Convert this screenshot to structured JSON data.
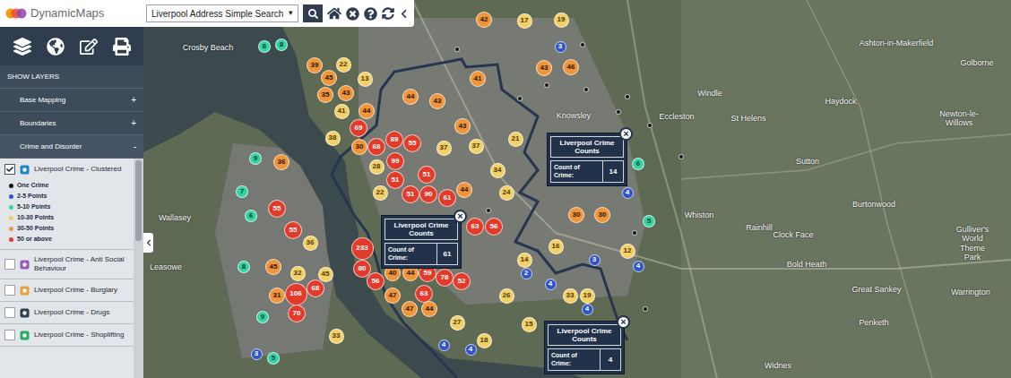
{
  "app": {
    "logo_text": "DynamicMaps"
  },
  "search": {
    "value": "Liverpool Address Simple Search",
    "caret": "▾"
  },
  "sidebar": {
    "header": "SHOW LAYERS",
    "groups": [
      {
        "label": "Base Mapping",
        "toggle": "+",
        "expanded": false
      },
      {
        "label": "Boundaries",
        "toggle": "+",
        "expanded": false
      },
      {
        "label": "Crime and Disorder",
        "toggle": "-",
        "expanded": true
      }
    ],
    "layers": [
      {
        "label": "Liverpool Crime - Clustered",
        "checked": true
      },
      {
        "label": "Liverpool Crime - Anti Social Behaviour",
        "checked": false
      },
      {
        "label": "Liverpool Crime - Burglary",
        "checked": false
      },
      {
        "label": "Liverpool Crime - Drugs",
        "checked": false
      },
      {
        "label": "Liverpool Crime - Shoplifting",
        "checked": false
      }
    ],
    "legend": [
      {
        "label": "One Crime",
        "color": "#111111"
      },
      {
        "label": "2-5 Points",
        "color": "#2f55c8"
      },
      {
        "label": "5-10 Points",
        "color": "#34d3a4"
      },
      {
        "label": "10-30 Points",
        "color": "#f2d067"
      },
      {
        "label": "30-50 Points",
        "color": "#f0953a"
      },
      {
        "label": "50 or above",
        "color": "#e23b2b"
      }
    ]
  },
  "map": {
    "place_labels": [
      "Crosby Beach",
      "Wallasey",
      "Leasowe",
      "Knowsley",
      "Windle",
      "Eccleston",
      "St Helens",
      "Haydock",
      "Ashton-in-Makerfield",
      "Golborne",
      "Newton-le-Willows",
      "Sutton",
      "Whiston",
      "Rainhill",
      "Clock Face",
      "Burtonwood",
      "Bold Heath",
      "Great Sankey",
      "Warrington",
      "Penketh",
      "Widnes",
      "Gulliver's World Theme Park"
    ],
    "pins": [
      {
        "count": "6",
        "color": "#34d3a4"
      },
      {
        "count": "8",
        "color": "#34d3a4"
      },
      {
        "count": "39",
        "color": "#f0953a"
      },
      {
        "count": "22",
        "color": "#f2d067"
      },
      {
        "count": "45",
        "color": "#f0953a"
      },
      {
        "count": "35",
        "color": "#f0953a"
      },
      {
        "count": "43",
        "color": "#f0953a"
      },
      {
        "count": "13",
        "color": "#f2d067"
      },
      {
        "count": "41",
        "color": "#f2d067"
      },
      {
        "count": "44",
        "color": "#f0953a"
      },
      {
        "count": "38",
        "color": "#f2d067"
      },
      {
        "count": "69",
        "color": "#e23b2b"
      },
      {
        "count": "30",
        "color": "#f0953a"
      },
      {
        "count": "68",
        "color": "#e23b2b"
      },
      {
        "count": "89",
        "color": "#e23b2b"
      },
      {
        "count": "55",
        "color": "#e23b2b"
      },
      {
        "count": "99",
        "color": "#e23b2b"
      },
      {
        "count": "28",
        "color": "#f2d067"
      },
      {
        "count": "51",
        "color": "#e23b2b"
      },
      {
        "count": "51",
        "color": "#e23b2b"
      },
      {
        "count": "51",
        "color": "#e23b2b"
      },
      {
        "count": "90",
        "color": "#e23b2b"
      },
      {
        "count": "61",
        "color": "#e23b2b"
      },
      {
        "count": "44",
        "color": "#f0953a"
      },
      {
        "count": "22",
        "color": "#f2d067"
      },
      {
        "count": "44",
        "color": "#f0953a"
      },
      {
        "count": "43",
        "color": "#f0953a"
      },
      {
        "count": "43",
        "color": "#f0953a"
      },
      {
        "count": "41",
        "color": "#f0953a"
      },
      {
        "count": "42",
        "color": "#f0953a"
      },
      {
        "count": "43",
        "color": "#f0953a"
      },
      {
        "count": "46",
        "color": "#f0953a"
      },
      {
        "count": "17",
        "color": "#f2d067"
      },
      {
        "count": "19",
        "color": "#f2d067"
      },
      {
        "count": "37",
        "color": "#f2d067"
      },
      {
        "count": "37",
        "color": "#f2d067"
      },
      {
        "count": "34",
        "color": "#f2d067"
      },
      {
        "count": "21",
        "color": "#f2d067"
      },
      {
        "count": "24",
        "color": "#f2d067"
      },
      {
        "count": "36",
        "color": "#f0953a"
      },
      {
        "count": "55",
        "color": "#e23b2b"
      },
      {
        "count": "55",
        "color": "#e23b2b"
      },
      {
        "count": "36",
        "color": "#f2d067"
      },
      {
        "count": "45",
        "color": "#f0953a"
      },
      {
        "count": "32",
        "color": "#f2d067"
      },
      {
        "count": "45",
        "color": "#f2d067"
      },
      {
        "count": "31",
        "color": "#f0953a"
      },
      {
        "count": "106",
        "color": "#e23b2b"
      },
      {
        "count": "68",
        "color": "#e23b2b"
      },
      {
        "count": "70",
        "color": "#e23b2b"
      },
      {
        "count": "33",
        "color": "#f2d067"
      },
      {
        "count": "233",
        "color": "#e23b2b"
      },
      {
        "count": "80",
        "color": "#e23b2b"
      },
      {
        "count": "56",
        "color": "#e23b2b"
      },
      {
        "count": "40",
        "color": "#f0953a"
      },
      {
        "count": "44",
        "color": "#f0953a"
      },
      {
        "count": "59",
        "color": "#e23b2b"
      },
      {
        "count": "78",
        "color": "#e23b2b"
      },
      {
        "count": "52",
        "color": "#e23b2b"
      },
      {
        "count": "63",
        "color": "#e23b2b"
      },
      {
        "count": "47",
        "color": "#f0953a"
      },
      {
        "count": "47",
        "color": "#f0953a"
      },
      {
        "count": "44",
        "color": "#f0953a"
      },
      {
        "count": "63",
        "color": "#e23b2b"
      },
      {
        "count": "56",
        "color": "#e23b2b"
      },
      {
        "count": "30",
        "color": "#f0953a"
      },
      {
        "count": "30",
        "color": "#f0953a"
      },
      {
        "count": "33",
        "color": "#f2d067"
      },
      {
        "count": "19",
        "color": "#f2d067"
      },
      {
        "count": "16",
        "color": "#f2d067"
      },
      {
        "count": "12",
        "color": "#f2d067"
      },
      {
        "count": "14",
        "color": "#f2d067"
      },
      {
        "count": "26",
        "color": "#f2d067"
      },
      {
        "count": "15",
        "color": "#f2d067"
      },
      {
        "count": "18",
        "color": "#f2d067"
      },
      {
        "count": "27",
        "color": "#f2d067"
      },
      {
        "count": "9",
        "color": "#34d3a4"
      },
      {
        "count": "7",
        "color": "#34d3a4"
      },
      {
        "count": "6",
        "color": "#34d3a4"
      },
      {
        "count": "8",
        "color": "#34d3a4"
      },
      {
        "count": "9",
        "color": "#34d3a4"
      },
      {
        "count": "3",
        "color": "#2f55c8"
      },
      {
        "count": "5",
        "color": "#34d3a4"
      },
      {
        "count": "5",
        "color": "#34d3a4"
      },
      {
        "count": "6",
        "color": "#34d3a4"
      },
      {
        "count": "4",
        "color": "#2f55c8"
      },
      {
        "count": "4",
        "color": "#2f55c8"
      },
      {
        "count": "2",
        "color": "#2f55c8"
      },
      {
        "count": "4",
        "color": "#2f55c8"
      },
      {
        "count": "3",
        "color": "#2f55c8"
      },
      {
        "count": "4",
        "color": "#2f55c8"
      },
      {
        "count": "3",
        "color": "#2f55c8"
      },
      {
        "count": "4",
        "color": "#2f55c8"
      },
      {
        "count": "4",
        "color": "#2f55c8"
      },
      {
        "color": "#111111"
      },
      {
        "color": "#111111"
      },
      {
        "color": "#111111"
      },
      {
        "color": "#111111"
      },
      {
        "color": "#111111"
      },
      {
        "color": "#111111"
      },
      {
        "color": "#111111"
      },
      {
        "color": "#111111"
      },
      {
        "color": "#111111"
      },
      {
        "color": "#111111"
      },
      {
        "color": "#111111"
      },
      {
        "color": "#111111"
      }
    ],
    "popups": [
      {
        "title": "Liverpool Crime Counts",
        "field": "Count of Crime:",
        "value": "14",
        "close": "×"
      },
      {
        "title": "Liverpool Crime Counts",
        "field": "Count of Crime:",
        "value": "61",
        "close": "×"
      },
      {
        "title": "Liverpool Crime Counts",
        "field": "Count of Crime:",
        "value": "4",
        "close": "×"
      }
    ]
  }
}
